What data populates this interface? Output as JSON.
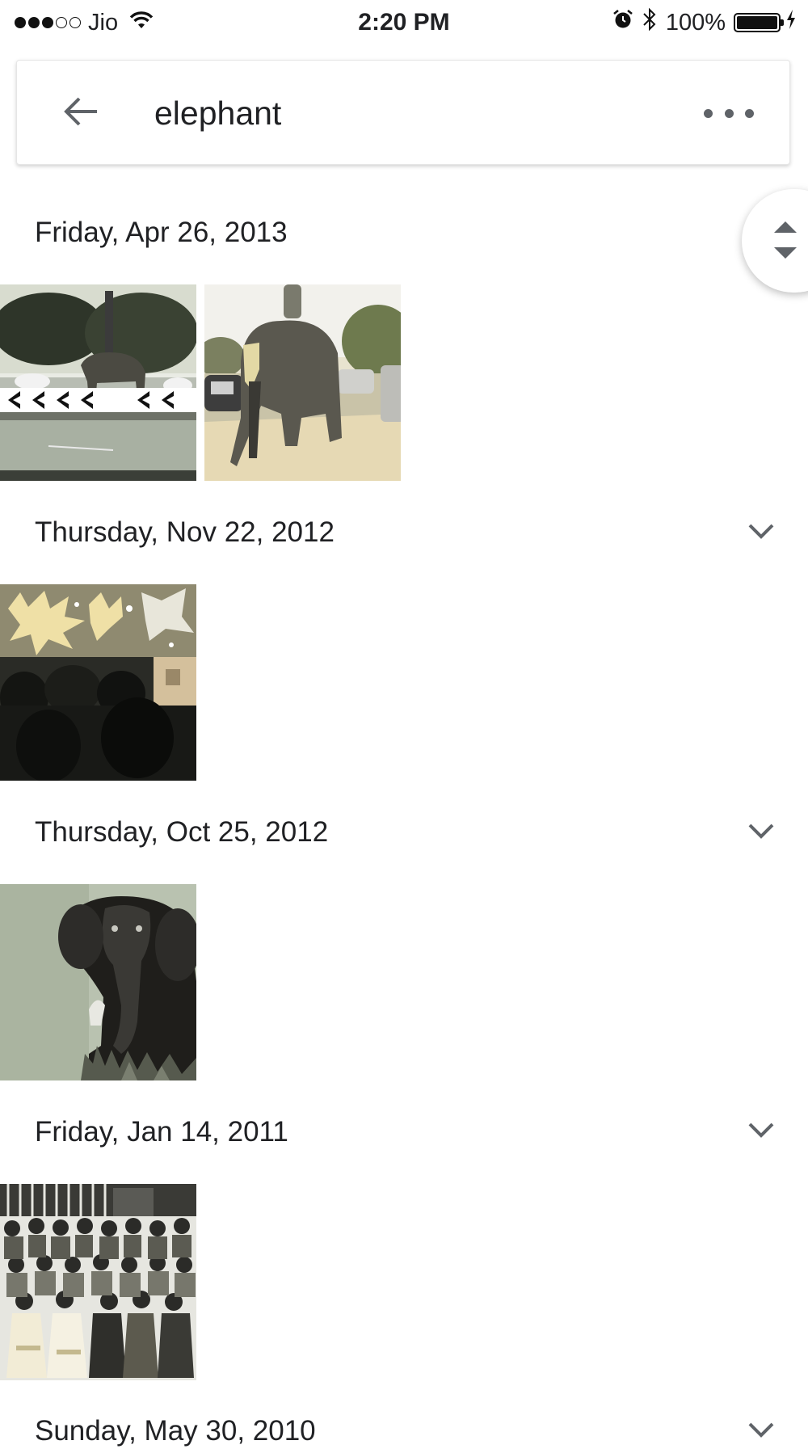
{
  "status_bar": {
    "carrier": "Jio",
    "time": "2:20 PM",
    "battery": "100%"
  },
  "search": {
    "query": "elephant"
  },
  "groups": [
    {
      "date": "Friday, Apr 26, 2013",
      "photo_count": 2
    },
    {
      "date": "Thursday, Nov 22, 2012",
      "photo_count": 1
    },
    {
      "date": "Thursday, Oct 25, 2012",
      "photo_count": 1
    },
    {
      "date": "Friday, Jan 14, 2011",
      "photo_count": 1
    },
    {
      "date": "Sunday, May 30, 2010",
      "photo_count": 0
    }
  ],
  "icons": {
    "back": "arrow-back-icon",
    "more": "more-horiz-icon",
    "expand": "chevron-down-icon",
    "fast_scroll": "fast-scroll-icon"
  }
}
